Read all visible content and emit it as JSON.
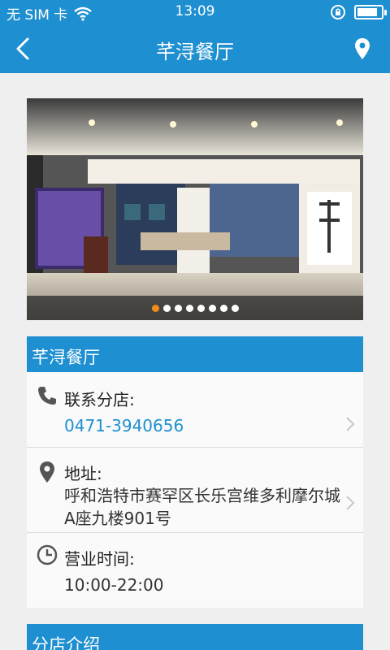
{
  "status": {
    "carrier": "无 SIM 卡",
    "time": "13:09",
    "battery_level": 0.85
  },
  "nav": {
    "title": "芊浔餐厅"
  },
  "carousel": {
    "total": 8,
    "active_index": 0
  },
  "info": {
    "header": "芊浔餐厅",
    "contact_label": "联系分店:",
    "phone": "0471-3940656",
    "address_label": "地址:",
    "address": "呼和浩特市赛罕区长乐宫维多利摩尔城A座九楼901号",
    "hours_label": "营业时间:",
    "hours": "10:00-22:00"
  },
  "intro": {
    "header": "分店介绍"
  },
  "colors": {
    "brand": "#1e8fd0",
    "accent": "#f08d1a"
  }
}
